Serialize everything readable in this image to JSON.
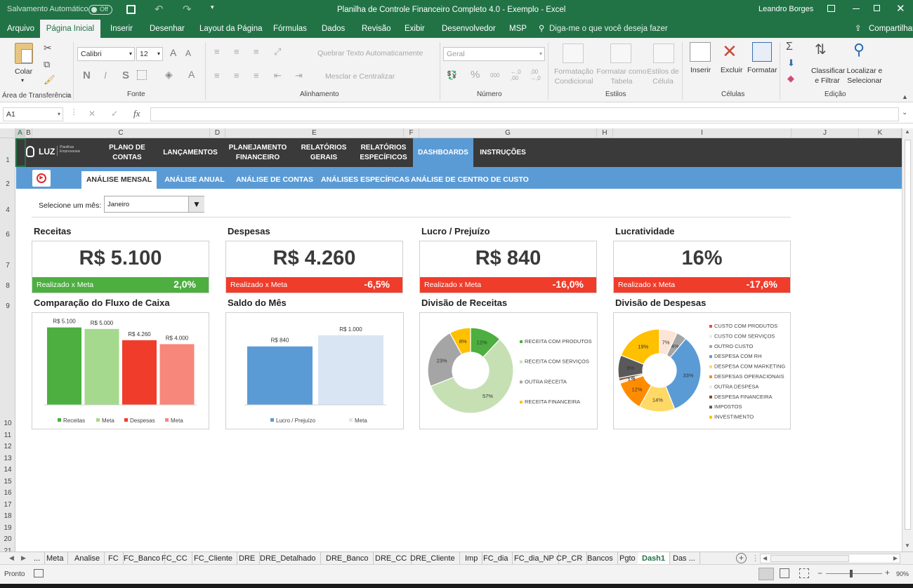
{
  "titlebar": {
    "autosave": "Salvamento Automático",
    "autosave_state": "Off",
    "title": "Planilha de Controle Financeiro Completo 4.0 - Exemplo  -  Excel",
    "user": "Leandro Borges"
  },
  "ribbon_tabs": [
    "Arquivo",
    "Página Inicial",
    "Inserir",
    "Desenhar",
    "Layout da Página",
    "Fórmulas",
    "Dados",
    "Revisão",
    "Exibir",
    "Desenvolvedor",
    "MSP"
  ],
  "ribbon_tab_active": "Página Inicial",
  "tell_me": "Diga-me o que você deseja fazer",
  "share": "Compartilhar",
  "ribbon": {
    "paste": "Colar",
    "font_name": "Calibri",
    "font_size": "12",
    "bold": "N",
    "strike": "S",
    "wrap_text": "Quebrar Texto Automaticamente",
    "merge_center": "Mesclar e Centralizar",
    "number_format": "Geral",
    "percent": "%",
    "thousands": "000",
    "cond_format": "Formatação Condicional",
    "format_table": "Formatar como Tabela",
    "cell_styles": "Estilos de Célula",
    "insert": "Inserir",
    "delete": "Excluir",
    "format": "Formatar",
    "sort_filter": "Classificar e Filtrar",
    "find_select": "Localizar e Selecionar",
    "groups": {
      "clipboard": "Área de Transferência",
      "font": "Fonte",
      "alignment": "Alinhamento",
      "number": "Número",
      "styles": "Estilos",
      "cells": "Células",
      "editing": "Edição"
    }
  },
  "formula_bar": {
    "name_box": "A1",
    "fx": "fx",
    "formula": ""
  },
  "columns": [
    "A",
    "B",
    "C",
    "D",
    "E",
    "F",
    "G",
    "H",
    "I",
    "J",
    "K"
  ],
  "rows": [
    "1",
    "2",
    "4",
    "6",
    "7",
    "8",
    "9",
    "10",
    "11",
    "12",
    "13",
    "14",
    "15",
    "16",
    "17",
    "18",
    "19",
    "20",
    "21"
  ],
  "nav": {
    "logo": "LUZ",
    "logo_sub": "Planilhas Empresariais",
    "items": [
      "PLANO DE CONTAS",
      "LANÇAMENTOS",
      "PLANEJAMENTO FINANCEIRO",
      "RELATÓRIOS GERAIS",
      "RELATÓRIOS ESPECÍFICOS",
      "DASHBOARDS",
      "INSTRUÇÕES"
    ],
    "active": "DASHBOARDS"
  },
  "subnav": {
    "items": [
      "ANÁLISE MENSAL",
      "ANÁLISE ANUAL",
      "ANÁLISE DE CONTAS",
      "ANÁLISES ESPECÍFICAS",
      "ANÁLISE DE CENTRO DE CUSTO"
    ],
    "active": "ANÁLISE MENSAL"
  },
  "month_selector": {
    "label": "Selecione um mês:",
    "value": "Janeiro"
  },
  "kpis": [
    {
      "title": "Receitas",
      "value": "R$ 5.100",
      "bar_label": "Realizado x Meta",
      "bar_value": "2,0%",
      "bar_color": "#4caf3f"
    },
    {
      "title": "Despesas",
      "value": "R$ 4.260",
      "bar_label": "Realizado x Meta",
      "bar_value": "-6,5%",
      "bar_color": "#f03c2b"
    },
    {
      "title": "Lucro / Prejuízo",
      "value": "R$ 840",
      "bar_label": "Realizado x Meta",
      "bar_value": "-16,0%",
      "bar_color": "#f03c2b"
    },
    {
      "title": "Lucratividade",
      "value": "16%",
      "bar_label": "Realizado x Meta",
      "bar_value": "-17,6%",
      "bar_color": "#f03c2b"
    }
  ],
  "chart_titles": [
    "Comparação do Fluxo de Caixa",
    "Saldo do Mês",
    "Divisão de Receitas",
    "Divisão de Despesas"
  ],
  "chart_data": [
    {
      "type": "bar",
      "title": "Comparação do Fluxo de Caixa",
      "categories": [
        "Receitas",
        "Meta",
        "Despesas",
        "Meta"
      ],
      "values": [
        5100,
        5000,
        4260,
        4000
      ],
      "labels": [
        "R$ 5.100",
        "R$ 5.000",
        "R$ 4.260",
        "R$ 4.000"
      ],
      "colors": [
        "#4caf3f",
        "#a5d98e",
        "#f03c2b",
        "#f7877a"
      ],
      "legend": [
        "Receitas",
        "Meta",
        "Despesas",
        "Meta"
      ],
      "legend_position": "bottom"
    },
    {
      "type": "bar",
      "title": "Saldo do Mês",
      "categories": [
        "Lucro / Prejuízo",
        "Meta"
      ],
      "values": [
        840,
        1000
      ],
      "labels": [
        "R$ 840",
        "R$ 1.000"
      ],
      "colors": [
        "#5b9bd5",
        "#dae5f3"
      ],
      "legend": [
        "Lucro / Prejuízo",
        "Meta"
      ],
      "legend_position": "bottom"
    },
    {
      "type": "pie",
      "title": "Divisão de Receitas",
      "categories": [
        "RECEITA COM PRODUTOS",
        "RECEITA COM SERVIÇOS",
        "OUTRA RECEITA",
        "RECEITA FINANCEIRA"
      ],
      "values": [
        12,
        57,
        23,
        8
      ],
      "labels": [
        "12%",
        "57%",
        "23%",
        "8%"
      ],
      "colors": [
        "#4caf3f",
        "#c6e0b4",
        "#a5a5a5",
        "#ffc000"
      ],
      "legend_position": "right"
    },
    {
      "type": "pie",
      "title": "Divisão de Despesas",
      "categories": [
        "CUSTO COM PRODUTOS",
        "CUSTO COM SERVIÇOS",
        "OUTRO CUSTO",
        "DESPESA COM RH",
        "DESPESA COM MARKETING",
        "DESPESAS OPERACIONAIS",
        "OUTRA DESPESA",
        "DESPESA FINANCEIRA",
        "IMPOSTOS",
        "INVESTIMENTO"
      ],
      "values": [
        0,
        7,
        4,
        33,
        14,
        12,
        1,
        1,
        9,
        19
      ],
      "labels": [
        "0%",
        "7%",
        "4%",
        "33%",
        "14%",
        "12%",
        "1%",
        "1%",
        "9%",
        "19%"
      ],
      "colors": [
        "#f04a3a",
        "#fce4d6",
        "#a5a5a5",
        "#5b9bd5",
        "#ffd966",
        "#ff8c00",
        "#fbe5d6",
        "#7b4a2a",
        "#595959",
        "#ffc000"
      ],
      "legend_position": "right"
    }
  ],
  "sheet_tabs": [
    "...",
    "Meta",
    "Analise",
    "FC",
    "FC_Banco",
    "FC_CC",
    "FC_Cliente",
    "DRE",
    "DRE_Detalhado",
    "DRE_Banco",
    "DRE_CC",
    "DRE_Cliente",
    "Imp",
    "FC_dia",
    "FC_dia_NP",
    "CP_CR",
    "Bancos",
    "Pgto",
    "Dash1",
    "Das ..."
  ],
  "sheet_active": "Dash1",
  "status": {
    "ready": "Pronto",
    "zoom": "90%"
  }
}
